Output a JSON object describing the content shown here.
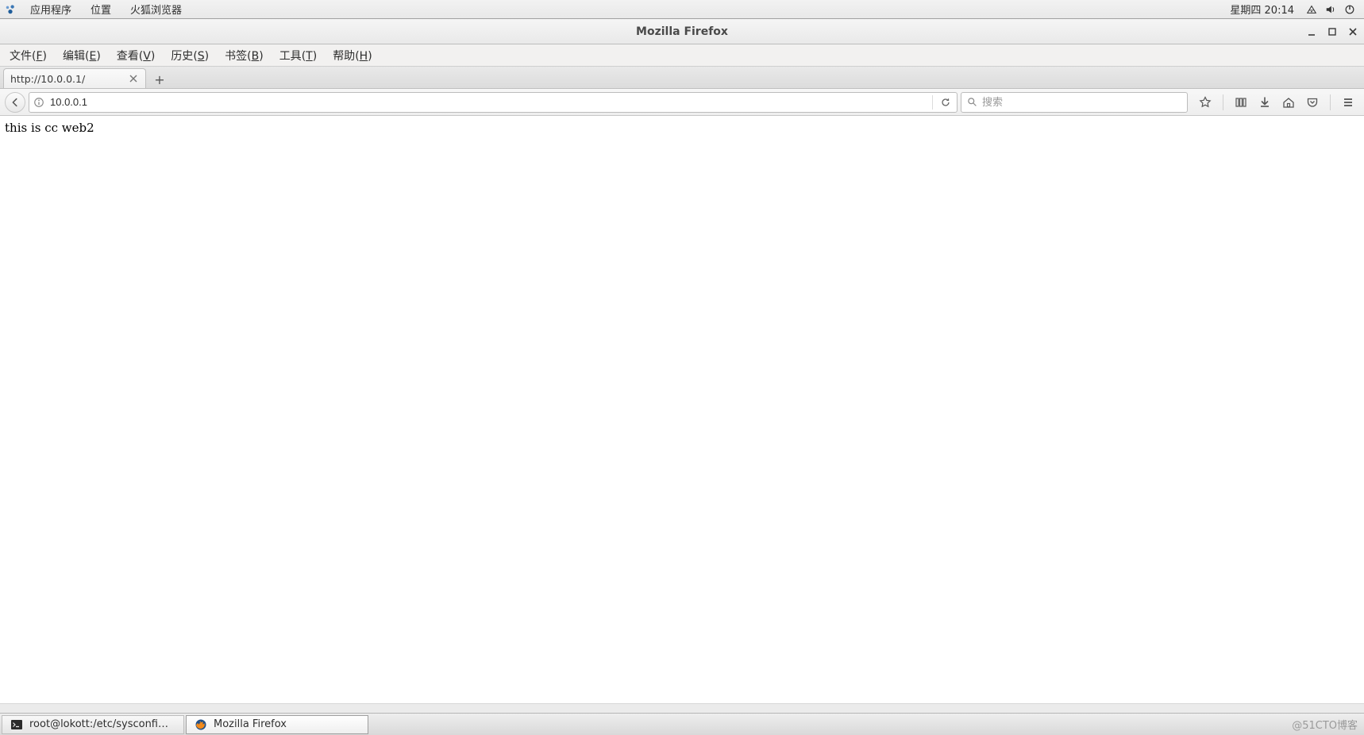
{
  "system_panel": {
    "menus": [
      "应用程序",
      "位置",
      "火狐浏览器"
    ],
    "clock": "星期四 20:14",
    "tray": [
      "network-icon",
      "volume-icon",
      "power-icon"
    ]
  },
  "window": {
    "title": "Mozilla Firefox",
    "controls": {
      "min": "minimize-icon",
      "max": "maximize-icon",
      "close": "close-icon"
    }
  },
  "menubar": [
    {
      "label": "文件",
      "accel": "F"
    },
    {
      "label": "编辑",
      "accel": "E"
    },
    {
      "label": "查看",
      "accel": "V"
    },
    {
      "label": "历史",
      "accel": "S"
    },
    {
      "label": "书签",
      "accel": "B"
    },
    {
      "label": "工具",
      "accel": "T"
    },
    {
      "label": "帮助",
      "accel": "H"
    }
  ],
  "tabs": {
    "active": {
      "title": "http://10.0.0.1/"
    },
    "new_tab_glyph": "+"
  },
  "address_bar": {
    "url": "10.0.0.1",
    "identity_icon": "info-icon",
    "reload_icon": "reload-icon"
  },
  "search_bar": {
    "placeholder": "搜索",
    "icon": "magnify-icon"
  },
  "toolbar_icons": [
    "star-icon",
    "library-icon",
    "downloads-icon",
    "home-icon",
    "pocket-icon",
    "hamburger-icon"
  ],
  "page": {
    "content_text": "this  is  cc  web2"
  },
  "taskbar": {
    "items": [
      {
        "icon": "terminal-icon",
        "label": "root@lokott:/etc/sysconfig/networ…",
        "active": false
      },
      {
        "icon": "firefox-icon",
        "label": "Mozilla Firefox",
        "active": true
      }
    ]
  },
  "watermark": "@51CTO博客"
}
